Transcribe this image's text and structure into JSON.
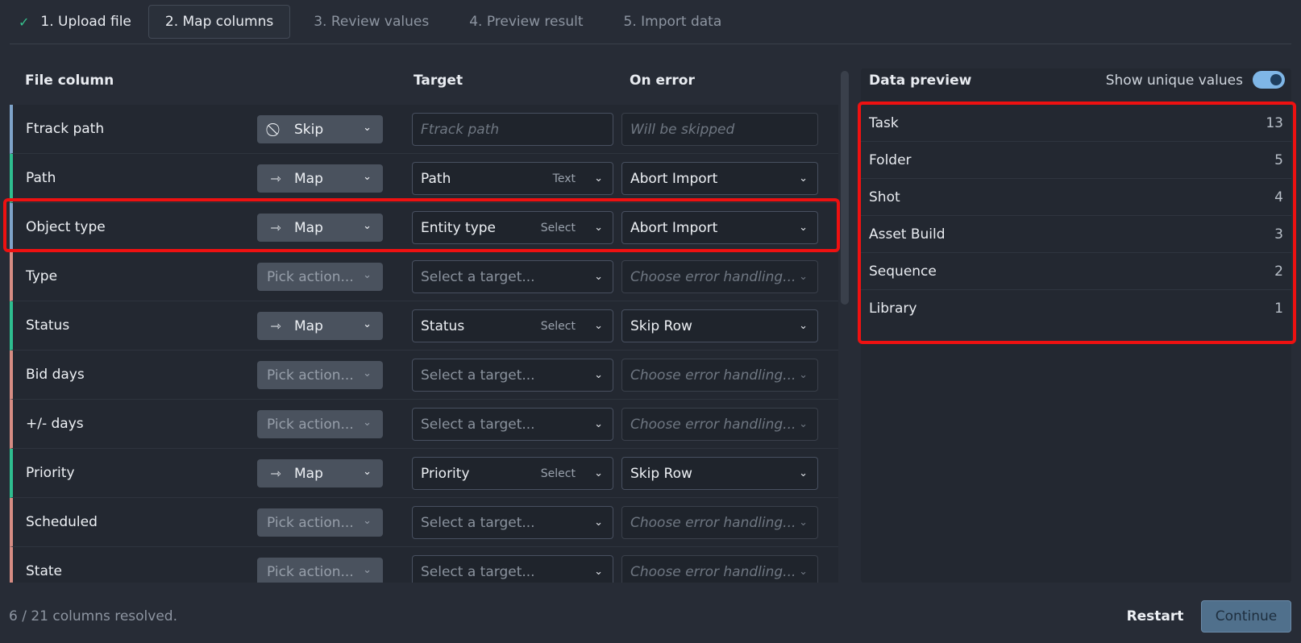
{
  "steps": [
    {
      "label": "1. Upload file",
      "state": "done"
    },
    {
      "label": "2. Map columns",
      "state": "active"
    },
    {
      "label": "3. Review values",
      "state": "pending"
    },
    {
      "label": "4. Preview result",
      "state": "pending"
    },
    {
      "label": "5. Import data",
      "state": "pending"
    }
  ],
  "headers": {
    "file_column": "File column",
    "target": "Target",
    "on_error": "On error"
  },
  "rows": [
    {
      "label": "Ftrack path",
      "action": "Skip",
      "action_icon": "skip-icon",
      "target": "Ftrack path",
      "target_type": "",
      "error": "Will be skipped"
    },
    {
      "label": "Path",
      "action": "Map",
      "action_icon": "map-arrow-icon",
      "target": "Path",
      "target_type": "Text",
      "error": "Abort Import"
    },
    {
      "label": "Object type",
      "action": "Map",
      "action_icon": "map-arrow-icon",
      "target": "Entity type",
      "target_type": "Select",
      "error": "Abort Import"
    },
    {
      "label": "Type",
      "action": "Pick action...",
      "action_icon": "",
      "target": "Select a target...",
      "target_type": "",
      "error": "Choose error handling..."
    },
    {
      "label": "Status",
      "action": "Map",
      "action_icon": "map-arrow-icon",
      "target": "Status",
      "target_type": "Select",
      "error": "Skip Row"
    },
    {
      "label": "Bid days",
      "action": "Pick action...",
      "action_icon": "",
      "target": "Select a target...",
      "target_type": "",
      "error": "Choose error handling..."
    },
    {
      "label": "+/- days",
      "action": "Pick action...",
      "action_icon": "",
      "target": "Select a target...",
      "target_type": "",
      "error": "Choose error handling..."
    },
    {
      "label": "Priority",
      "action": "Map",
      "action_icon": "map-arrow-icon",
      "target": "Priority",
      "target_type": "Select",
      "error": "Skip Row"
    },
    {
      "label": "Scheduled",
      "action": "Pick action...",
      "action_icon": "",
      "target": "Select a target...",
      "target_type": "",
      "error": "Choose error handling..."
    },
    {
      "label": "State",
      "action": "Pick action...",
      "action_icon": "",
      "target": "Select a target...",
      "target_type": "",
      "error": "Choose error handling..."
    }
  ],
  "preview": {
    "title": "Data preview",
    "toggle_label": "Show unique values",
    "toggle_on": true,
    "items": [
      {
        "label": "Task",
        "count": "13"
      },
      {
        "label": "Folder",
        "count": "5"
      },
      {
        "label": "Shot",
        "count": "4"
      },
      {
        "label": "Asset Build",
        "count": "3"
      },
      {
        "label": "Sequence",
        "count": "2"
      },
      {
        "label": "Library",
        "count": "1"
      }
    ]
  },
  "footer": {
    "status": "6 / 21 columns resolved.",
    "restart": "Restart",
    "continue": "Continue"
  },
  "colors": {
    "accent": "#7fb6e6",
    "success": "#2ebd8f",
    "unresolved": "#d68c83",
    "highlight": "#ee1111"
  }
}
